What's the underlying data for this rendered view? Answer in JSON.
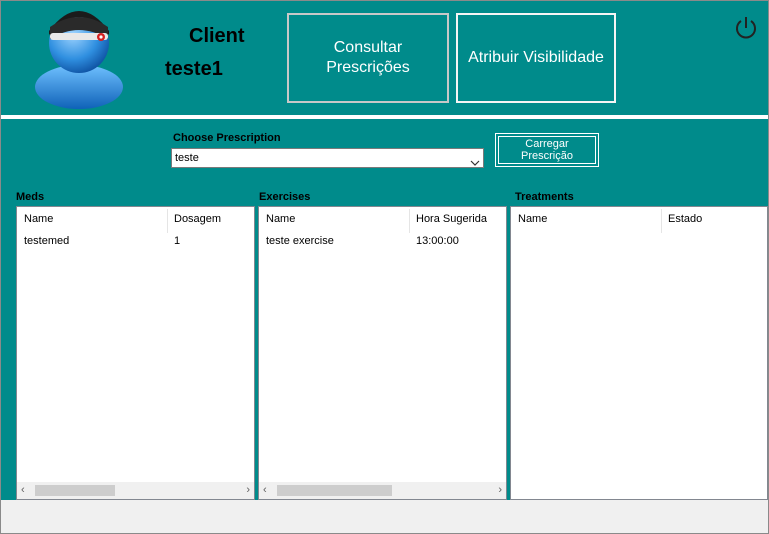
{
  "header": {
    "client_label": "Client",
    "client_name": "teste1",
    "consultar_button": "Consultar Prescrições",
    "atribuir_button": "Atribuir Visibilidade"
  },
  "prescription": {
    "label": "Choose Prescription",
    "selected": "teste",
    "load_button": "Carregar Prescrição"
  },
  "meds": {
    "title": "Meds",
    "columns": [
      "Name",
      "Dosagem"
    ],
    "rows": [
      [
        "testemed",
        "1"
      ]
    ]
  },
  "exercises": {
    "title": "Exercises",
    "columns": [
      "Name",
      "Hora Sugerida"
    ],
    "rows": [
      [
        "teste exercise",
        "13:00:00"
      ]
    ]
  },
  "treatments": {
    "title": "Treatments",
    "columns": [
      "Name",
      "Estado"
    ],
    "rows": []
  },
  "colors": {
    "teal": "#008b8b",
    "white": "#ffffff"
  },
  "icons": {
    "avatar": "user-avatar-icon",
    "power": "power-icon",
    "dropdown": "chevron-down-icon"
  }
}
